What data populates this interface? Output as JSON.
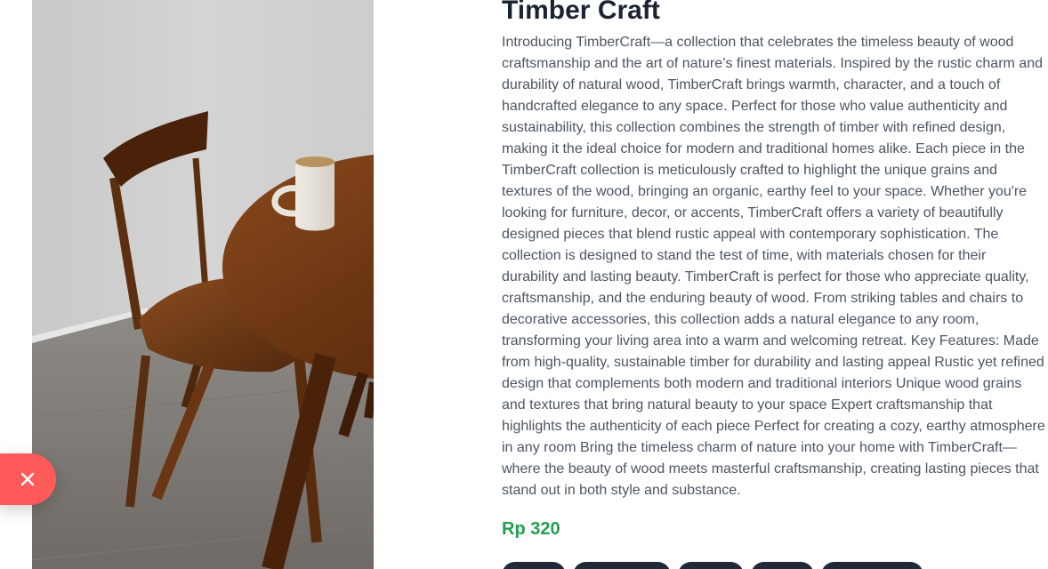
{
  "product": {
    "title": "Timber Craft",
    "description": "Introducing TimberCraft—a collection that celebrates the timeless beauty of wood craftsmanship and the art of nature’s finest materials. Inspired by the rustic charm and durability of natural wood, TimberCraft brings warmth, character, and a touch of handcrafted elegance to any space. Perfect for those who value authenticity and sustainability, this collection combines the strength of timber with refined design, making it the ideal choice for modern and traditional homes alike. Each piece in the TimberCraft collection is meticulously crafted to highlight the unique grains and textures of the wood, bringing an organic, earthy feel to your space. Whether you're looking for furniture, decor, or accents, TimberCraft offers a variety of beautifully designed pieces that blend rustic appeal with contemporary sophistication. The collection is designed to stand the test of time, with materials chosen for their durability and lasting beauty. TimberCraft is perfect for those who appreciate quality, craftsmanship, and the enduring beauty of wood. From striking tables and chairs to decorative accessories, this collection adds a natural elegance to any room, transforming your living area into a warm and welcoming retreat. Key Features: Made from high-quality, sustainable timber for durability and lasting appeal Rustic yet refined design that complements both modern and traditional interiors Unique wood grains and textures that bring natural beauty to your space Expert craftsmanship that highlights the authenticity of each piece Perfect for creating a cozy, earthy atmosphere in any room Bring the timeless charm of nature into your home with TimberCraft—where the beauty of wood meets masterful craftsmanship, creating lasting pieces that stand out in both style and substance.",
    "price": "Rp 320"
  },
  "close_button": {
    "icon": "close-icon"
  },
  "tags": [
    "",
    "",
    "",
    "",
    ""
  ],
  "colors": {
    "accent_close": "#ff5a5a",
    "price": "#22a04b",
    "title": "#1b2333",
    "body_text": "#4b5563",
    "tag_chip": "#1f2937"
  }
}
